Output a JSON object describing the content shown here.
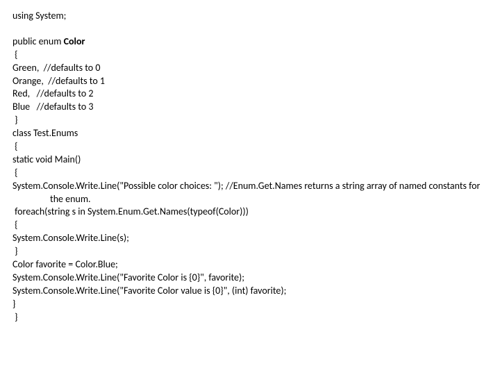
{
  "code": {
    "l01": "using System;",
    "l02_a": "public enum ",
    "l02_b": "Color",
    "l03": " {",
    "l04": "Green,  //defaults to 0",
    "l05": "Orange,  //defaults to 1",
    "l06": "Red,   //defaults to 2",
    "l07": "Blue   //defaults to 3",
    "l08": " }",
    "l09": "class Test.Enums",
    "l10": " {",
    "l11": "static void Main()",
    "l12": " {",
    "l13": "System.Console.Write.Line(\"Possible color choices: \"); //Enum.Get.Names returns a string array of named constants for the enum.",
    "l14": " foreach(string s in System.Enum.Get.Names(typeof(Color)))",
    "l15": " {",
    "l16": "System.Console.Write.Line(s);",
    "l17": " }",
    "l18": "Color favorite = Color.Blue;",
    "l19": "System.Console.Write.Line(\"Favorite Color is {0}\", favorite);",
    "l20": "System.Console.Write.Line(\"Favorite Color value is {0}\", (int) favorite);",
    "l21": "}",
    "l22": " }"
  }
}
